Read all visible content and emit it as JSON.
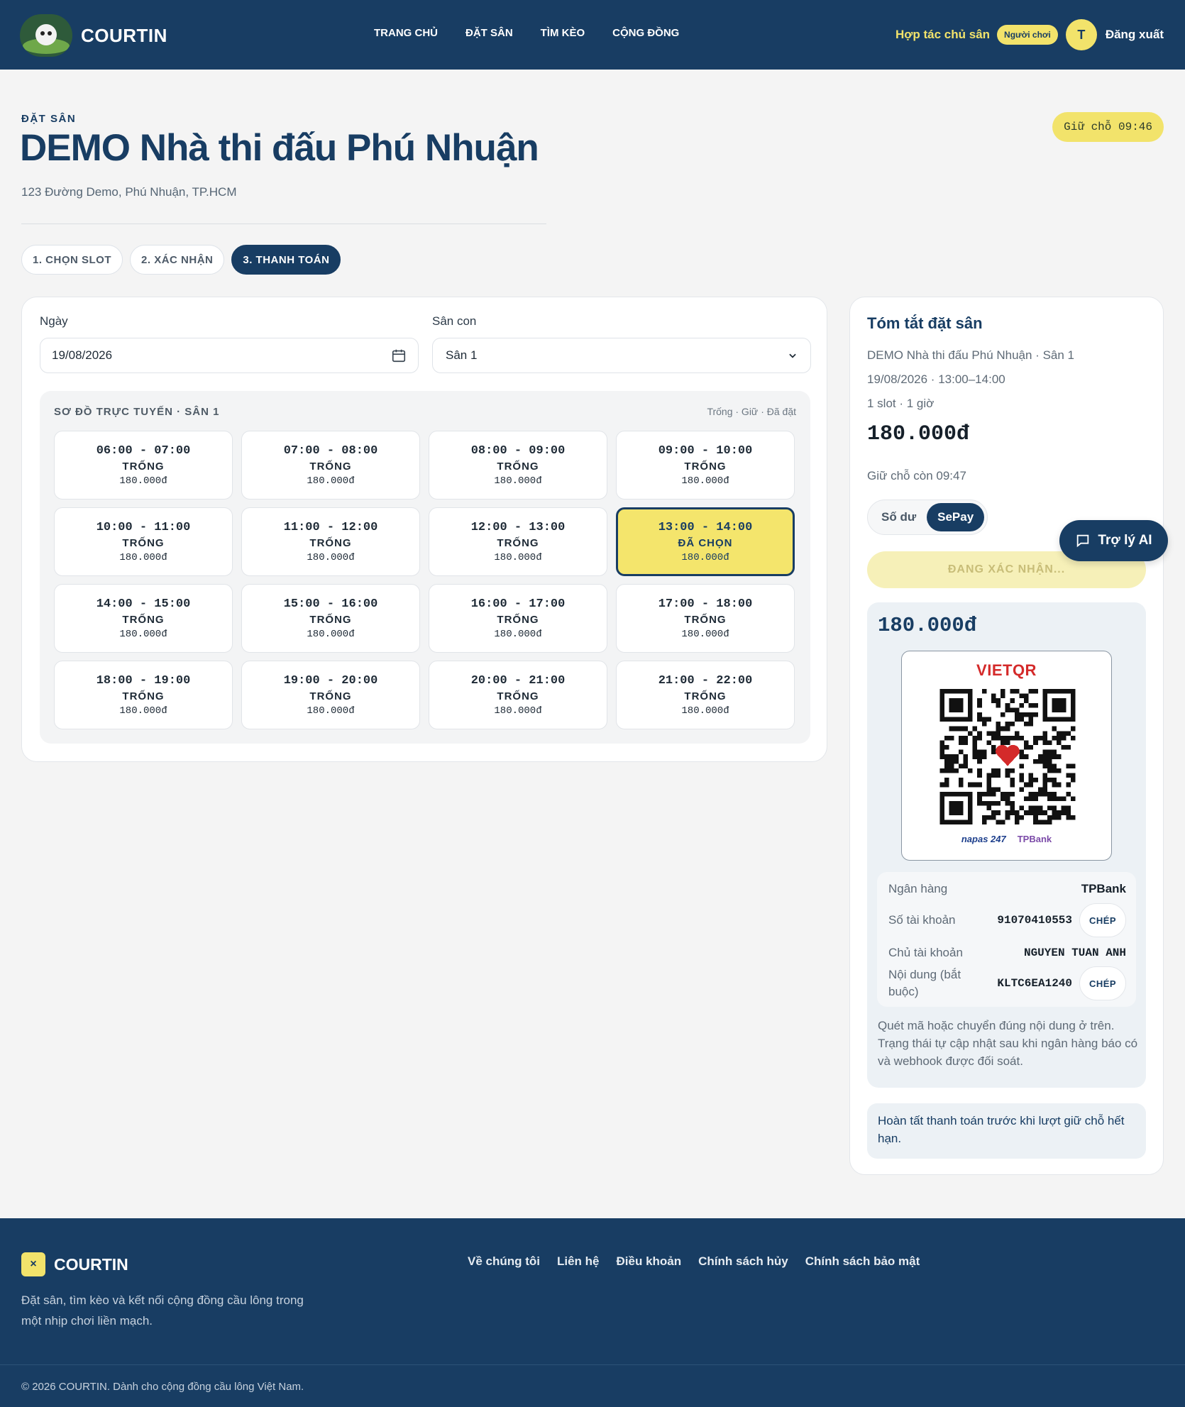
{
  "header": {
    "brand": "COURTIN",
    "nav": [
      "TRANG CHỦ",
      "ĐẶT SÂN",
      "TÌM KÈO",
      "CỘNG ĐỒNG"
    ],
    "partner_link": "Hợp tác chủ sân",
    "role_badge": "Người chơi",
    "avatar_initial": "T",
    "logout": "Đăng xuất"
  },
  "page": {
    "eyebrow": "ĐẶT SÂN",
    "title": "DEMO Nhà thi đấu Phú Nhuận",
    "address": "123 Đường Demo, Phú Nhuận, TP.HCM",
    "hold_timer": "Giữ chỗ 09:46"
  },
  "steps": [
    "1. CHỌN SLOT",
    "2. XÁC NHẬN",
    "3. THANH TOÁN"
  ],
  "active_step": 3,
  "booking": {
    "date_label": "Ngày",
    "date_value": "19/08/2026",
    "court_label": "Sân con",
    "court_value": "Sân 1",
    "grid_title": "SƠ ĐỒ TRỰC TUYẾN · SÂN 1",
    "grid_legend": "Trống · Giữ · Đã đặt",
    "slots": [
      {
        "time": "06:00 - 07:00",
        "status": "TRỐNG",
        "price": "180.000đ"
      },
      {
        "time": "07:00 - 08:00",
        "status": "TRỐNG",
        "price": "180.000đ"
      },
      {
        "time": "08:00 - 09:00",
        "status": "TRỐNG",
        "price": "180.000đ"
      },
      {
        "time": "09:00 - 10:00",
        "status": "TRỐNG",
        "price": "180.000đ"
      },
      {
        "time": "10:00 - 11:00",
        "status": "TRỐNG",
        "price": "180.000đ"
      },
      {
        "time": "11:00 - 12:00",
        "status": "TRỐNG",
        "price": "180.000đ"
      },
      {
        "time": "12:00 - 13:00",
        "status": "TRỐNG",
        "price": "180.000đ"
      },
      {
        "time": "13:00 - 14:00",
        "status": "ĐÃ CHỌN",
        "price": "180.000đ"
      },
      {
        "time": "14:00 - 15:00",
        "status": "TRỐNG",
        "price": "180.000đ"
      },
      {
        "time": "15:00 - 16:00",
        "status": "TRỐNG",
        "price": "180.000đ"
      },
      {
        "time": "16:00 - 17:00",
        "status": "TRỐNG",
        "price": "180.000đ"
      },
      {
        "time": "17:00 - 18:00",
        "status": "TRỐNG",
        "price": "180.000đ"
      },
      {
        "time": "18:00 - 19:00",
        "status": "TRỐNG",
        "price": "180.000đ"
      },
      {
        "time": "19:00 - 20:00",
        "status": "TRỐNG",
        "price": "180.000đ"
      },
      {
        "time": "20:00 - 21:00",
        "status": "TRỐNG",
        "price": "180.000đ"
      },
      {
        "time": "21:00 - 22:00",
        "status": "TRỐNG",
        "price": "180.000đ"
      }
    ]
  },
  "summary": {
    "title": "Tóm tắt đặt sân",
    "venue_court": "DEMO Nhà thi đấu Phú Nhuận · Sân 1",
    "date_time": "19/08/2026 · 13:00–14:00",
    "slot_info": "1 slot · 1 giờ",
    "total": "180.000đ",
    "hold_remaining": "Giữ chỗ còn 09:47",
    "pay_options": [
      "Số dư",
      "SePay"
    ],
    "active_pay": "SePay",
    "confirm_button": "ĐANG XÁC NHẬN...",
    "qr_amount": "180.000đ",
    "qr_brand": "VIETQR",
    "qr_footer_left": "napas 247",
    "qr_footer_right": "TPBank",
    "bank": {
      "bank_label": "Ngân hàng",
      "bank_value": "TPBank",
      "account_label": "Số tài khoản",
      "account_value": "91070410553",
      "holder_label": "Chủ tài khoản",
      "holder_value": "NGUYEN TUAN ANH",
      "content_label": "Nội dung (bắt buộc)",
      "content_value": "KLTC6EA1240",
      "copy_label": "CHÉP"
    },
    "note": "Quét mã hoặc chuyển đúng nội dung ở trên. Trạng thái tự cập nhật sau khi ngân hàng báo có và webhook được đối soát.",
    "warning": "Hoàn tất thanh toán trước khi lượt giữ chỗ hết hạn."
  },
  "assistant_button": "Trợ lý AI",
  "footer": {
    "brand": "COURTIN",
    "mark": "×",
    "description": "Đặt sân, tìm kèo và kết nối cộng đồng cầu lông trong một nhịp chơi liền mạch.",
    "links": [
      "Về chúng tôi",
      "Liên hệ",
      "Điều khoản",
      "Chính sách hủy",
      "Chính sách bảo mật"
    ],
    "copyright": "© 2026 COURTIN. Dành cho cộng đồng cầu lông Việt Nam."
  },
  "colors": {
    "navy": "#183d63",
    "accent_yellow": "#f2e36b",
    "selected_slot": "#f4e56c"
  }
}
